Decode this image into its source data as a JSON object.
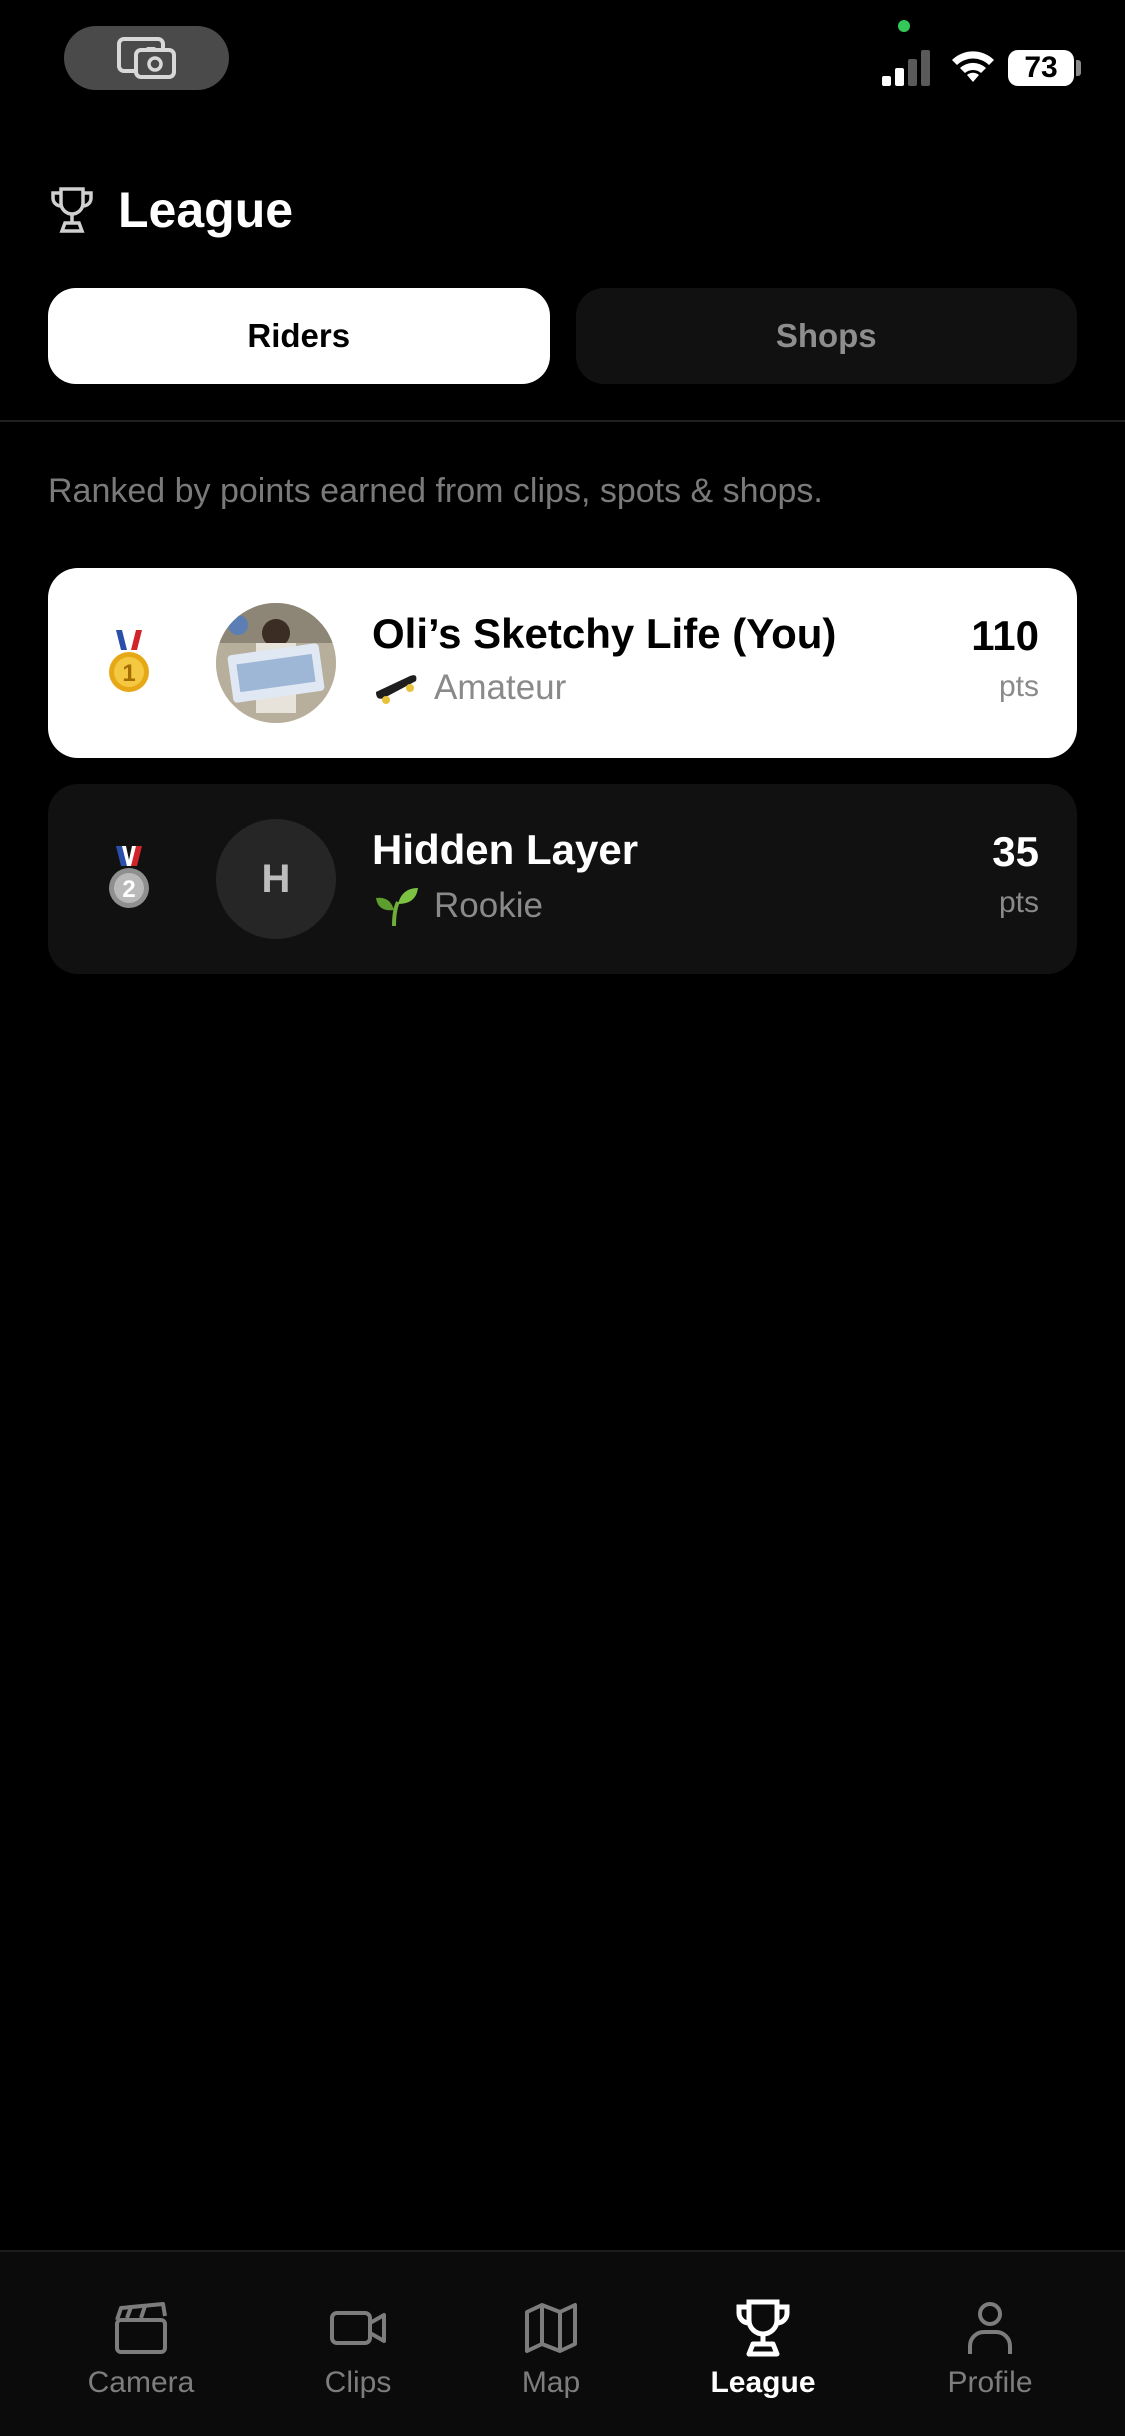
{
  "status_bar": {
    "battery": "73",
    "icons": [
      "screen-record-icon",
      "signal-icon",
      "wifi-icon",
      "battery-icon"
    ]
  },
  "header": {
    "icon": "trophy-icon",
    "title": "League"
  },
  "tabs": [
    {
      "label": "Riders",
      "active": true
    },
    {
      "label": "Shops",
      "active": false
    }
  ],
  "subtitle": "Ranked by points earned from clips, spots & shops.",
  "leaderboard": [
    {
      "rank": "1",
      "medal": "gold-medal-icon",
      "avatar": "photo",
      "name": "Oli’s Sketchy Life (You)",
      "level_icon": "skateboard-icon",
      "level": "Amateur",
      "points": "110",
      "points_unit": "pts"
    },
    {
      "rank": "2",
      "medal": "silver-medal-icon",
      "avatar_initial": "H",
      "name": "Hidden Layer",
      "level_icon": "seedling-icon",
      "level": "Rookie",
      "points": "35",
      "points_unit": "pts"
    }
  ],
  "tabbar": {
    "items": [
      {
        "label": "Camera",
        "icon": "clapperboard-icon",
        "active": false
      },
      {
        "label": "Clips",
        "icon": "video-camera-icon",
        "active": false
      },
      {
        "label": "Map",
        "icon": "map-icon",
        "active": false
      },
      {
        "label": "League",
        "icon": "trophy-icon",
        "active": true
      },
      {
        "label": "Profile",
        "icon": "person-icon",
        "active": false
      }
    ]
  },
  "colors": {
    "background": "#000000",
    "card_active": "#ffffff",
    "card_inactive": "#111111",
    "muted_text": "#7a7a7a",
    "gold": "#e6a817",
    "silver": "#9a9a9a"
  }
}
